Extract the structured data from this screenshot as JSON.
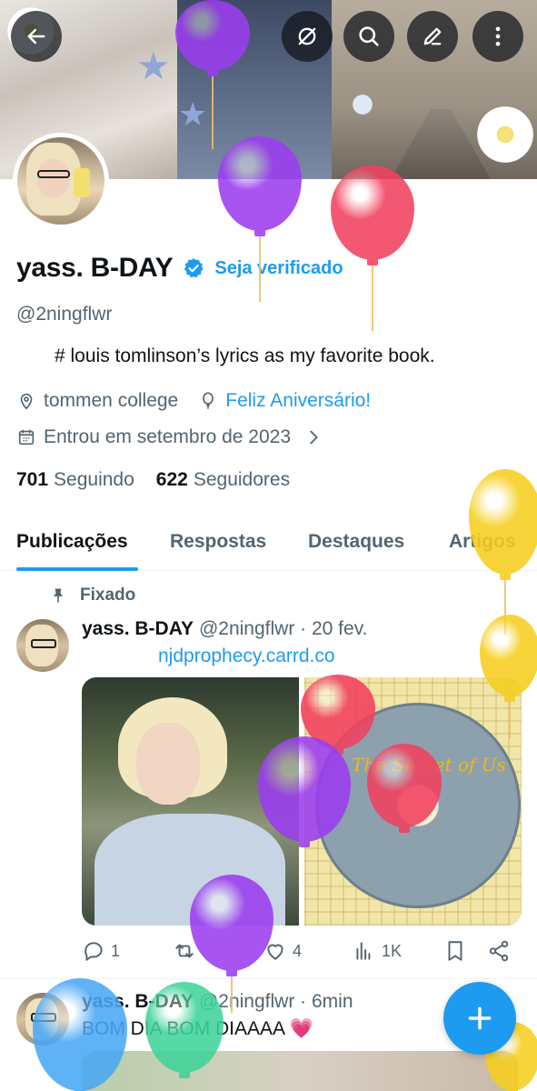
{
  "header": {
    "buttons": [
      {
        "name": "back-button",
        "icon": "arrow-left-icon"
      },
      {
        "name": "grok-button",
        "icon": "grok-icon"
      },
      {
        "name": "search-button",
        "icon": "search-icon"
      },
      {
        "name": "edit-button",
        "icon": "pencil-icon"
      },
      {
        "name": "more-button",
        "icon": "more-vertical-icon"
      }
    ]
  },
  "profile": {
    "display_name": "yass. B-DAY",
    "get_verified": "Seja verificado",
    "handle": "@2ningflwr",
    "bio": "# louis tomlinson’s lyrics as my favorite book.",
    "location": "tommen college",
    "birthday": "Feliz Aniversário!",
    "joined": "Entrou em setembro de 2023",
    "following_count": "701",
    "following_label": "Seguindo",
    "followers_count": "622",
    "followers_label": "Seguidores"
  },
  "tabs": [
    {
      "label": "Publicações",
      "active": true
    },
    {
      "label": "Respostas",
      "active": false
    },
    {
      "label": "Destaques",
      "active": false
    },
    {
      "label": "Artigos",
      "active": false
    }
  ],
  "posts": [
    {
      "pinned_label": "Fixado",
      "name": "yass. B-DAY",
      "handle_time": "@2ningflwr · 20 fev.",
      "link": "njdprophecy.carrd.co",
      "media_text": "The Secret of Us",
      "replies": "1",
      "reposts": "",
      "likes": "4",
      "views": "1K"
    },
    {
      "name": "yass. B-DAY",
      "handle_time": "@2ningflwr · 6min",
      "text": "BOM DIA BOM DIAAAA 💗"
    }
  ],
  "colors": {
    "accent": "#1d9bf0",
    "text": "#0f1419",
    "muted": "#536471",
    "balloon_purple": "#9b3df0",
    "balloon_red": "#f2415f",
    "balloon_yellow": "#f6cf1f",
    "balloon_blue": "#4aa8f5",
    "balloon_green": "#3fd49a"
  }
}
